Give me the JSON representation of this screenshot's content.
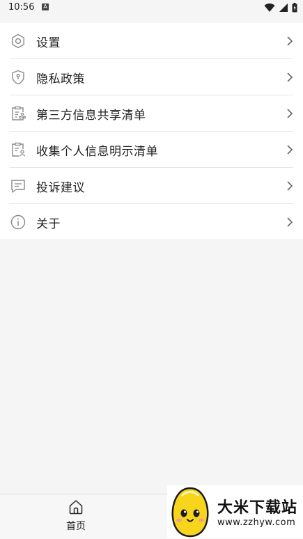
{
  "status_bar": {
    "time": "10:56",
    "notification_letter": "A"
  },
  "menu": [
    {
      "label": "设置",
      "icon": "gear-icon"
    },
    {
      "label": "隐私政策",
      "icon": "shield-icon"
    },
    {
      "label": "第三方信息共享清单",
      "icon": "share-list-icon"
    },
    {
      "label": "收集个人信息明示清单",
      "icon": "person-list-icon"
    },
    {
      "label": "投诉建议",
      "icon": "feedback-message-icon"
    },
    {
      "label": "关于",
      "icon": "info-icon"
    }
  ],
  "bottom_nav": {
    "home_label": "首页",
    "home_icon": "home-icon"
  },
  "watermark": {
    "title": "大米下载站",
    "url": "www.zzhyw.com"
  },
  "colors": {
    "background": "#f5f5f5",
    "card": "#ffffff",
    "icon": "#888888",
    "divider": "#e6e6e6"
  }
}
